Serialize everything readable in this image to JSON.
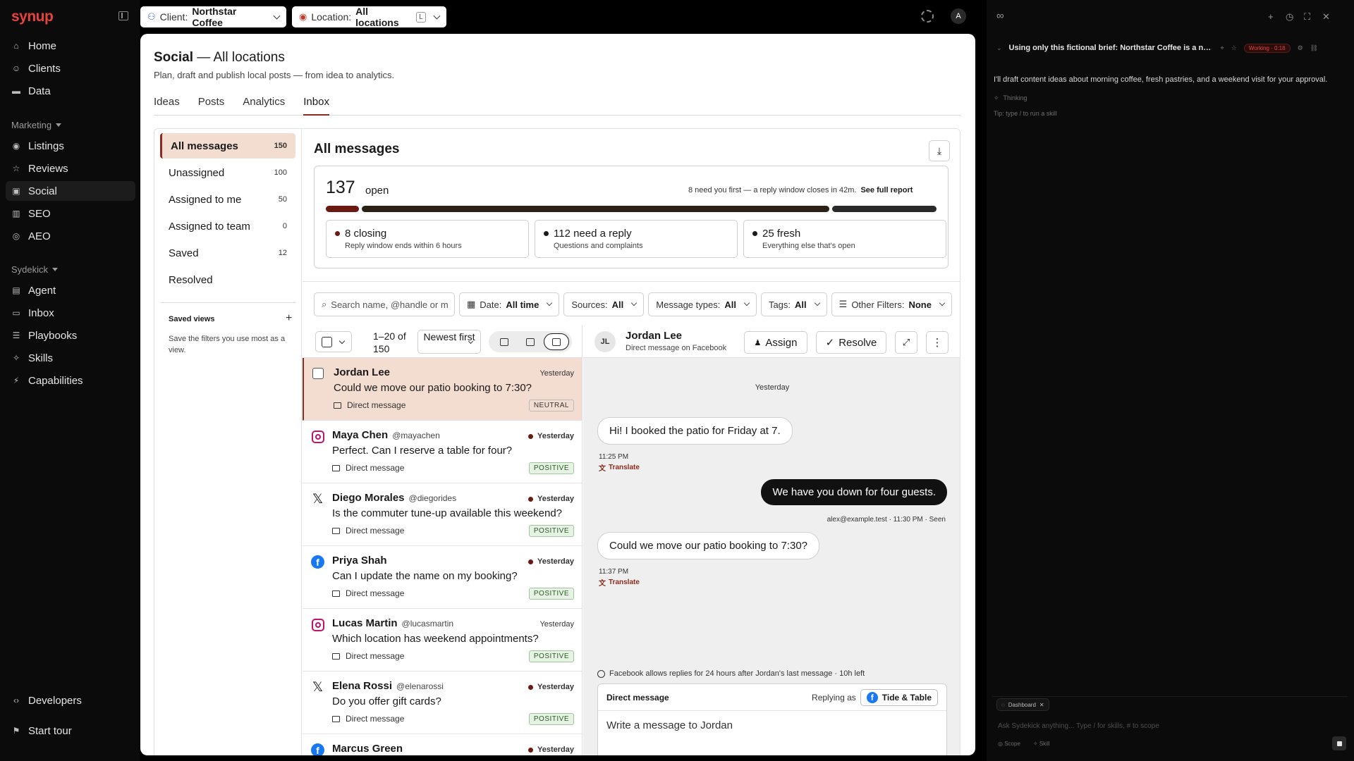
{
  "app": {
    "logo": "synup"
  },
  "topbar": {
    "client_label": "Client:",
    "client_value": "Northstar Coffee",
    "location_label": "Location:",
    "location_value": "All locations",
    "location_kbd": "L",
    "avatar": "A"
  },
  "sidebar": {
    "top": [
      {
        "label": "Home",
        "icon": "home-icon"
      },
      {
        "label": "Clients",
        "icon": "users-icon"
      },
      {
        "label": "Data",
        "icon": "folder-icon"
      }
    ],
    "marketing_label": "Marketing",
    "marketing": [
      {
        "label": "Listings",
        "icon": "map-pin-icon"
      },
      {
        "label": "Reviews",
        "icon": "star-icon"
      },
      {
        "label": "Social",
        "icon": "social-icon"
      },
      {
        "label": "SEO",
        "icon": "chart-icon"
      },
      {
        "label": "AEO",
        "icon": "aeo-icon"
      }
    ],
    "sydekick_label": "Sydekick",
    "sydekick": [
      {
        "label": "Agent",
        "icon": "agent-icon"
      },
      {
        "label": "Inbox",
        "icon": "inbox-icon"
      },
      {
        "label": "Playbooks",
        "icon": "playbook-icon"
      },
      {
        "label": "Skills",
        "icon": "sparkle-icon"
      },
      {
        "label": "Capabilities",
        "icon": "bolt-icon"
      }
    ],
    "developers": "Developers",
    "start_tour": "Start tour"
  },
  "page": {
    "title": "Social",
    "title_suffix": "— All locations",
    "subtitle": "Plan, draft and publish local posts — from idea to analytics.",
    "tabs": [
      "Ideas",
      "Posts",
      "Analytics",
      "Inbox"
    ],
    "active_tab": "Inbox"
  },
  "filters": {
    "items": [
      {
        "label": "All messages",
        "count": "150"
      },
      {
        "label": "Unassigned",
        "count": "100"
      },
      {
        "label": "Assigned to me",
        "count": "50"
      },
      {
        "label": "Assigned to team",
        "count": "0"
      },
      {
        "label": "Saved",
        "count": "12"
      },
      {
        "label": "Resolved",
        "count": ""
      }
    ],
    "saved_views_title": "Saved views",
    "saved_views_desc": "Save the filters you use most as a view."
  },
  "content": {
    "title": "All messages",
    "summary": {
      "count": "137",
      "count_label": "open",
      "note": "8 need you first — a reply window closes in 42m.",
      "report_link": "See full report",
      "segments": [
        {
          "value": 8,
          "color": "#6b1a12"
        },
        {
          "value": 112,
          "color": "#2b2116"
        },
        {
          "value": 25,
          "color": "#2a2a2a"
        }
      ],
      "cards": [
        {
          "title": "8 closing",
          "desc": "Reply window ends within 6 hours"
        },
        {
          "title": "112 need a reply",
          "desc": "Questions and complaints"
        },
        {
          "title": "25 fresh",
          "desc": "Everything else that's open"
        }
      ]
    },
    "filter_bar": {
      "search_placeholder": "Search name, @handle or m",
      "date_label": "Date:",
      "date_value": "All time",
      "sources_label": "Sources:",
      "sources_value": "All",
      "types_label": "Message types:",
      "types_value": "All",
      "tags_label": "Tags:",
      "tags_value": "All",
      "other_label": "Other Filters:",
      "other_value": "None"
    },
    "list_toolbar": {
      "range": "1–20 of 150",
      "sort": "Newest first"
    },
    "messages": [
      {
        "source": "facebook",
        "name": "Jordan Lee",
        "handle": "",
        "time": "Yesterday",
        "unread": false,
        "body": "Could we move our patio booking to 7:30?",
        "type": "Direct message",
        "sentiment": "NEUTRAL",
        "active": true
      },
      {
        "source": "instagram",
        "name": "Maya Chen",
        "handle": "@mayachen",
        "time": "Yesterday",
        "unread": true,
        "body": "Perfect. Can I reserve a table for four?",
        "type": "Direct message",
        "sentiment": "POSITIVE",
        "active": false
      },
      {
        "source": "x",
        "name": "Diego Morales",
        "handle": "@diegorides",
        "time": "Yesterday",
        "unread": true,
        "body": "Is the commuter tune-up available this weekend?",
        "type": "Direct message",
        "sentiment": "POSITIVE",
        "active": false
      },
      {
        "source": "facebook",
        "name": "Priya Shah",
        "handle": "",
        "time": "Yesterday",
        "unread": true,
        "body": "Can I update the name on my booking?",
        "type": "Direct message",
        "sentiment": "POSITIVE",
        "active": false
      },
      {
        "source": "instagram",
        "name": "Lucas Martin",
        "handle": "@lucasmartin",
        "time": "Yesterday",
        "unread": false,
        "body": "Which location has weekend appointments?",
        "type": "Direct message",
        "sentiment": "POSITIVE",
        "active": false
      },
      {
        "source": "x",
        "name": "Elena Rossi",
        "handle": "@elenarossi",
        "time": "Yesterday",
        "unread": true,
        "body": "Do you offer gift cards?",
        "type": "Direct message",
        "sentiment": "POSITIVE",
        "active": false
      },
      {
        "source": "facebook",
        "name": "Marcus Green",
        "handle": "",
        "time": "Yesterday",
        "unread": true,
        "body": "",
        "type": "",
        "sentiment": "",
        "active": false
      }
    ],
    "conversation": {
      "initials": "JL",
      "name": "Jordan Lee",
      "subtitle": "Direct message on Facebook",
      "assign": "Assign",
      "resolve": "Resolve",
      "day": "Yesterday",
      "msg1": "Hi! I booked the patio for Friday at 7.",
      "msg1_time": "11:25 PM",
      "translate": "Translate",
      "msg2": "We have you down for four guests.",
      "msg2_meta": "alex@example.test · 11:30 PM · Seen",
      "msg3": "Could we move our patio booking to 7:30?",
      "msg3_time": "11:37 PM",
      "reply_note": "Facebook allows replies for 24 hours after Jordan's last message · 10h left",
      "composer_label": "Direct message",
      "replying_as": "Replying as",
      "page_name": "Tide & Table",
      "placeholder": "Write a message to Jordan"
    }
  },
  "assistant": {
    "task_title": "Using only this fictional brief: Northstar Coffee is a neigh...",
    "working": "Working · 0:18",
    "text": "I'll draft content ideas about morning coffee, fresh pastries, and a weekend visit for your approval.",
    "thinking": "Thinking",
    "tip": "Tip: type / to run a skill",
    "chip": "Dashboard",
    "placeholder": "Ask Sydekick anything... Type / for skills, # to scope",
    "scope": "Scope",
    "skill": "Skill"
  }
}
